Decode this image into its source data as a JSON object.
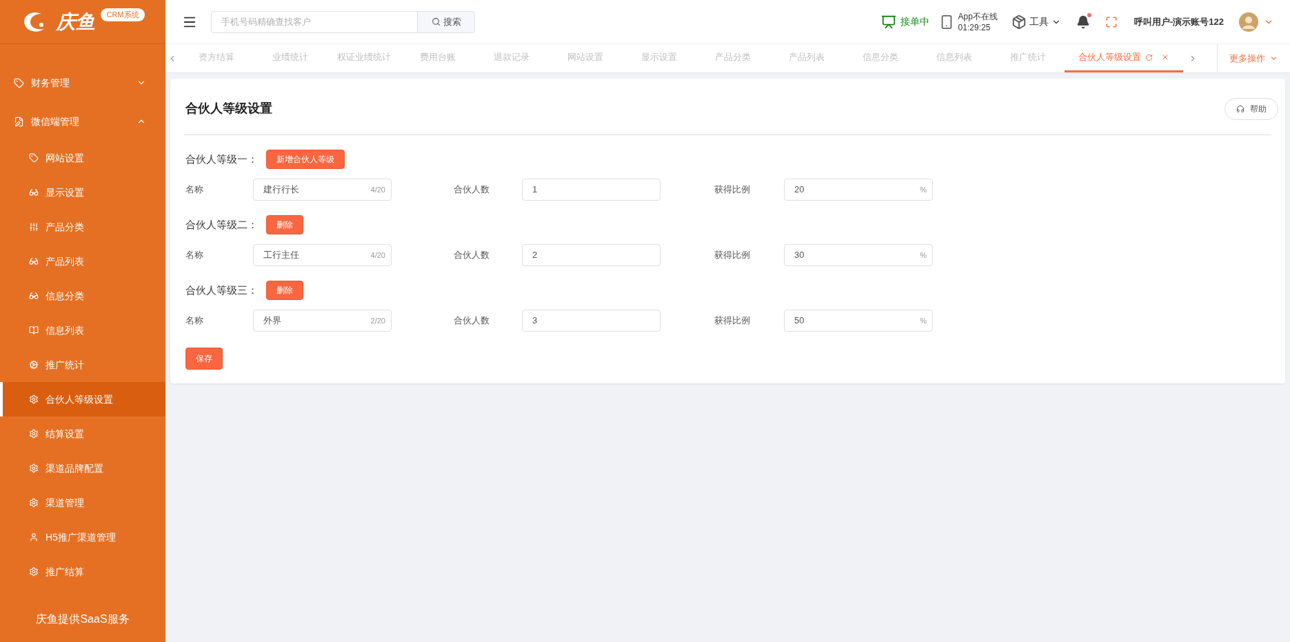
{
  "header": {
    "logo": {
      "name": "庆鱼",
      "badge": "CRM系统"
    },
    "search": {
      "placeholder": "手机号码精确查找客户",
      "button": "搜索"
    },
    "order_status": "接单中",
    "app_status": {
      "line_1": "App不在线",
      "line_2": "01:29:25"
    },
    "tools": "工具",
    "notifications": {
      "unread": true
    },
    "user": "呼叫用户-演示账号122"
  },
  "sidebar": {
    "groups": [
      {
        "label": "财务管理",
        "expanded": false
      },
      {
        "label": "微信端管理",
        "expanded": true,
        "children": [
          {
            "label": "网站设置",
            "selected": false
          },
          {
            "label": "显示设置",
            "selected": false
          },
          {
            "label": "产品分类",
            "selected": false
          },
          {
            "label": "产品列表",
            "selected": false
          },
          {
            "label": "信息分类",
            "selected": false
          },
          {
            "label": "信息列表",
            "selected": false
          },
          {
            "label": "推广统计",
            "selected": false
          },
          {
            "label": "合伙人等级设置",
            "selected": true
          },
          {
            "label": "结算设置",
            "selected": false
          },
          {
            "label": "渠道品牌配置",
            "selected": false
          },
          {
            "label": "渠道管理",
            "selected": false
          },
          {
            "label": "H5推广渠道管理",
            "selected": false
          },
          {
            "label": "推广结算",
            "selected": false
          }
        ]
      }
    ],
    "footer": "庆鱼提供SaaS服务"
  },
  "tabs": [
    {
      "label": "资方结算",
      "selected": false
    },
    {
      "label": "业绩统计",
      "selected": false
    },
    {
      "label": "权证业绩统计",
      "selected": false
    },
    {
      "label": "费用台账",
      "selected": false
    },
    {
      "label": "退款记录",
      "selected": false
    },
    {
      "label": "网站设置",
      "selected": false
    },
    {
      "label": "显示设置",
      "selected": false
    },
    {
      "label": "产品分类",
      "selected": false
    },
    {
      "label": "产品列表",
      "selected": false
    },
    {
      "label": "信息分类",
      "selected": false
    },
    {
      "label": "信息列表",
      "selected": false
    },
    {
      "label": "推广统计",
      "selected": false
    },
    {
      "label": "合伙人等级设置",
      "selected": true
    }
  ],
  "more_actions": "更多操作",
  "page": {
    "title": "合伙人等级设置",
    "help": "帮助",
    "levels": [
      {
        "title": "合伙人等级一：",
        "action": {
          "label": "新增合伙人等级"
        },
        "name_label": "名称",
        "name": "建行行长",
        "name_counter": "4/20",
        "count_label": "合伙人数",
        "count": "1",
        "ratio_label": "获得比例",
        "ratio": "20",
        "ratio_unit": "%"
      },
      {
        "title": "合伙人等级二：",
        "action": {
          "label": "删除"
        },
        "name_label": "名称",
        "name": "工行主任",
        "name_counter": "4/20",
        "count_label": "合伙人数",
        "count": "2",
        "ratio_label": "获得比例",
        "ratio": "30",
        "ratio_unit": "%"
      },
      {
        "title": "合伙人等级三：",
        "action": {
          "label": "删除"
        },
        "name_label": "名称",
        "name": "外界",
        "name_counter": "2/20",
        "count_label": "合伙人数",
        "count": "3",
        "ratio_label": "获得比例",
        "ratio": "50",
        "ratio_unit": "%"
      }
    ],
    "save": "保存"
  }
}
